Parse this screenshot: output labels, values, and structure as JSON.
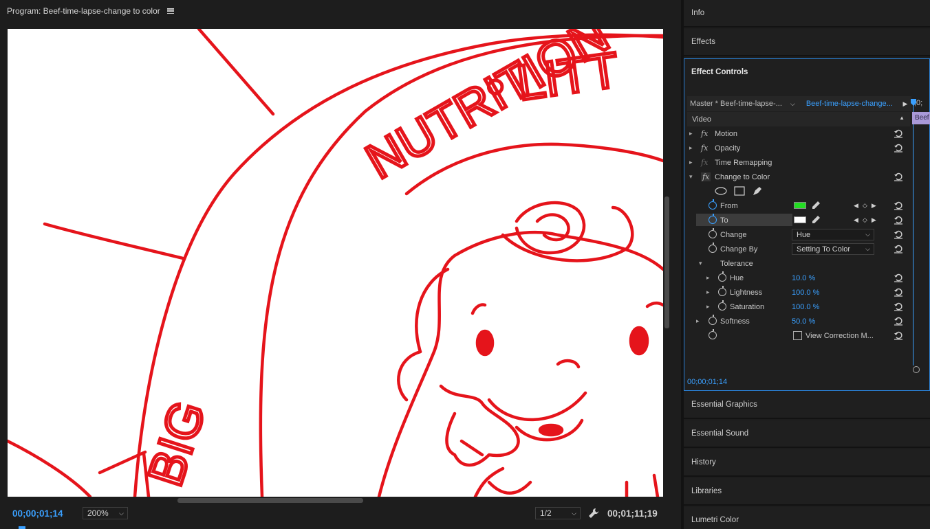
{
  "program": {
    "title": "Program: Beef-time-lapse-change to color",
    "timecode_current": "00;00;01;14",
    "zoom": "200%",
    "resolution": "1/2",
    "timecode_duration": "00;01;11;19",
    "frame_text": {
      "arc_outer": "• LITT",
      "arc_nutrition": "NUTRITION",
      "arc_big": "BIG"
    }
  },
  "panels": {
    "info": "Info",
    "effects": "Effects",
    "effect_controls": "Effect Controls",
    "essential_graphics": "Essential Graphics",
    "essential_sound": "Essential Sound",
    "history": "History",
    "libraries": "Libraries",
    "lumetri_color": "Lumetri Color"
  },
  "effect_controls": {
    "master": "Master * Beef-time-lapse-...",
    "clip": "Beef-time-lapse-change...",
    "timeline_head": ";0;",
    "clip_bar": "Beef",
    "section_video": "Video",
    "effects": {
      "motion": "Motion",
      "opacity": "Opacity",
      "time_remapping": "Time Remapping",
      "change_to_color": "Change to Color"
    },
    "params": {
      "from": "From",
      "to": "To",
      "change": "Change",
      "change_value": "Hue",
      "change_by": "Change By",
      "change_by_value": "Setting To Color",
      "tolerance": "Tolerance",
      "hue": "Hue",
      "hue_value": "10.0 %",
      "lightness": "Lightness",
      "lightness_value": "100.0 %",
      "saturation": "Saturation",
      "saturation_value": "100.0 %",
      "softness": "Softness",
      "softness_value": "50.0 %",
      "view_correction": "View Correction M..."
    },
    "colors": {
      "from": "#22dd22",
      "to": "#ffffff",
      "accent": "#3aa0ff"
    },
    "timecode": "00;00;01;14"
  }
}
